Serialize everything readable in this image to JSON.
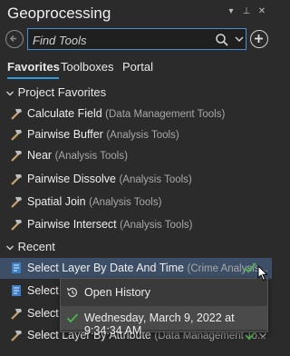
{
  "window": {
    "title": "Geoprocessing"
  },
  "search": {
    "placeholder": "Find Tools"
  },
  "tabs": [
    {
      "label": "Favorites",
      "active": true
    },
    {
      "label": "Toolboxes",
      "active": false
    },
    {
      "label": "Portal",
      "active": false
    }
  ],
  "project_favorites": {
    "header": "Project Favorites",
    "tools": [
      {
        "name": "Calculate Field",
        "toolbox": "(Data Management Tools)"
      },
      {
        "name": "Pairwise Buffer",
        "toolbox": "(Analysis Tools)"
      },
      {
        "name": "Near",
        "toolbox": "(Analysis Tools)"
      },
      {
        "name": "Pairwise Dissolve",
        "toolbox": "(Analysis Tools)"
      },
      {
        "name": "Spatial Join",
        "toolbox": "(Analysis Tools)"
      },
      {
        "name": "Pairwise Intersect",
        "toolbox": "(Analysis Tools)"
      }
    ]
  },
  "recent": {
    "header": "Recent",
    "tools": [
      {
        "name": "Select Layer By Date And Time",
        "toolbox": "(Crime Analysis..."
      },
      {
        "name": "Select N",
        "toolbox": ""
      },
      {
        "name": "Select L",
        "toolbox": ""
      },
      {
        "name": "Select Layer By Attribute",
        "toolbox": "(Data Management To..."
      }
    ]
  },
  "context_menu": {
    "items": [
      {
        "label": "Open History",
        "icon": "history-icon"
      },
      {
        "label": "Wednesday, March 9, 2022 at 9:34:34 AM",
        "icon": "check-icon"
      }
    ]
  },
  "colors": {
    "accent": "#2f9bd9",
    "success": "#4caf50",
    "selected_row": "#3d4f66"
  }
}
